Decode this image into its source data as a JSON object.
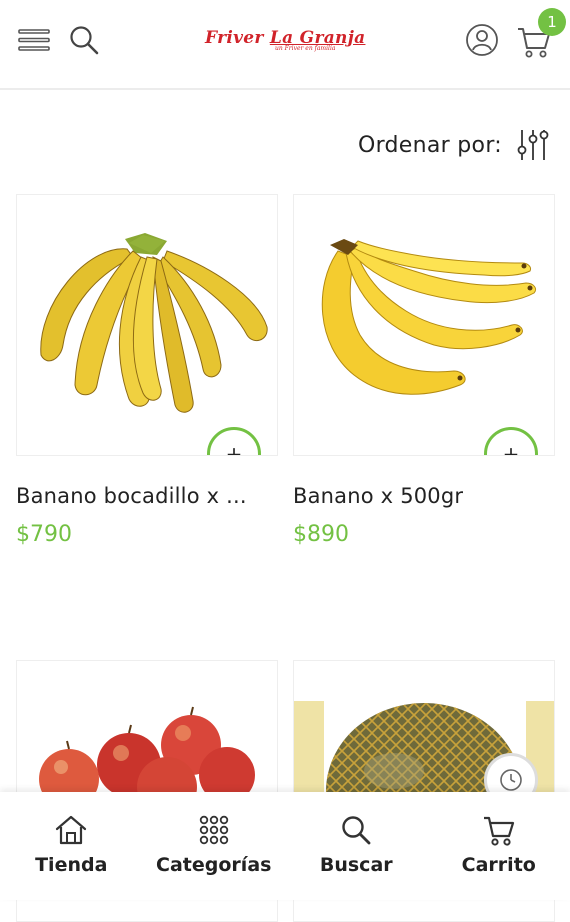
{
  "header": {
    "menu_icon": "hamburger-menu-icon",
    "search_icon": "search-icon",
    "logo_primary": "Friver",
    "logo_secondary": "La Granja",
    "logo_tagline": "un Friver en familia",
    "account_icon": "user-circle-icon",
    "cart_icon": "cart-icon",
    "cart_count": "1",
    "accent_color": "#73c143"
  },
  "sort": {
    "label": "Ordenar por:",
    "icon": "sliders-icon"
  },
  "products": [
    {
      "name": "Banano bocadillo x ...",
      "price": "$790",
      "image": "baby-bananas-bunch"
    },
    {
      "name": "Banano x 500gr",
      "price": "$890",
      "image": "bananas-bunch"
    },
    {
      "name": "",
      "price": "",
      "image": "red-apples"
    },
    {
      "name": "",
      "price": "",
      "image": "melon-in-net"
    }
  ],
  "add_button_label": "+",
  "bottom_nav": [
    {
      "label": "Tienda",
      "icon": "home-icon"
    },
    {
      "label": "Categorías",
      "icon": "grid-dots-icon"
    },
    {
      "label": "Buscar",
      "icon": "search-icon"
    },
    {
      "label": "Carrito",
      "icon": "cart-icon"
    }
  ]
}
